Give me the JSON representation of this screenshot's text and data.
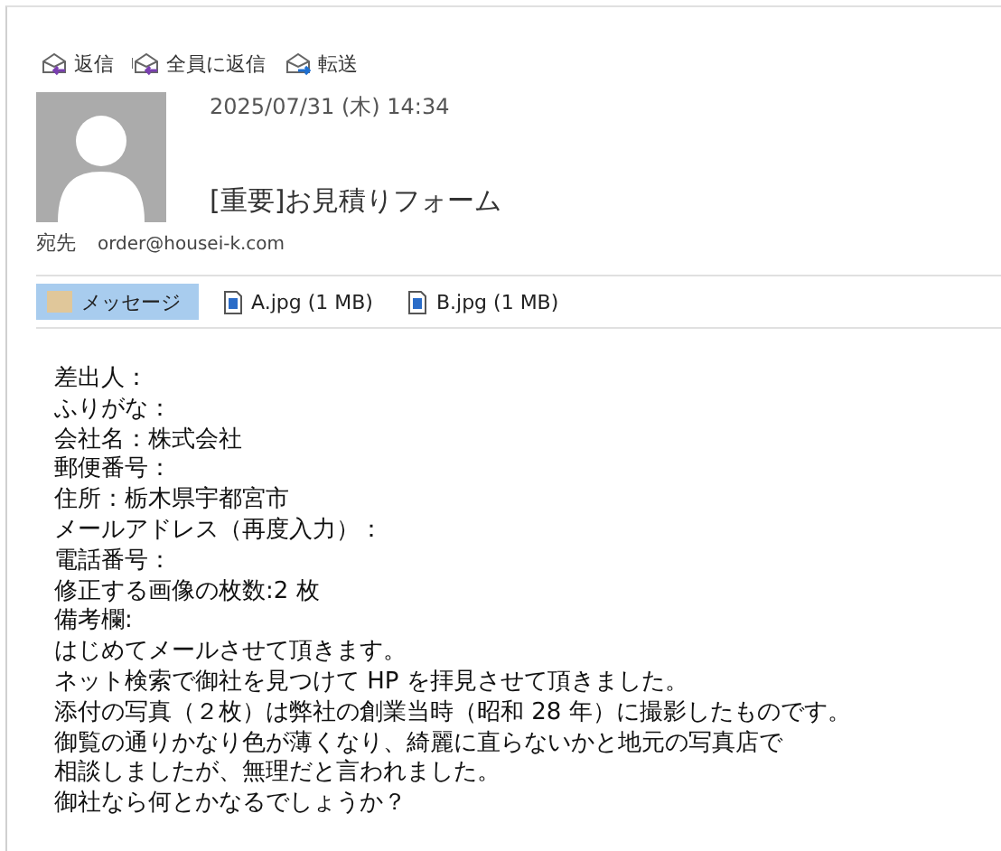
{
  "toolbar": [
    {
      "label": "返信",
      "kind": "reply"
    },
    {
      "label": "全員に返信",
      "kind": "reply_all"
    },
    {
      "label": "転送",
      "kind": "forward"
    }
  ],
  "message": {
    "date": "2025/07/31 (木) 14:34",
    "subject": "[重要]お見積りフォーム",
    "to_label": "宛先",
    "to": "order@housei-k.com"
  },
  "attachments": [
    {
      "label": "メッセージ",
      "kind": "message",
      "selected": true
    },
    {
      "label": "A.jpg (1 MB)",
      "kind": "file",
      "selected": false
    },
    {
      "label": "B.jpg (1 MB)",
      "kind": "file",
      "selected": false
    }
  ],
  "body": [
    "差出人：",
    "ふりがな：",
    "会社名：株式会社",
    "郵便番号：",
    "住所：栃木県宇都宮市",
    "メールアドレス（再度入力）：",
    "電話番号：",
    "修正する画像の枚数:2 枚",
    "備考欄:",
    "はじめてメールさせて頂きます。",
    "ネット検索で御社を見つけて HP を拝見させて頂きました。",
    "添付の写真（２枚）は弊社の創業当時（昭和 28 年）に撮影したものです。",
    "御覧の通りかなり色が薄くなり、綺麗に直らないかと地元の写真店で",
    "相談しましたが、無理だと言われました。",
    "御社なら何とかなるでしょうか？"
  ]
}
